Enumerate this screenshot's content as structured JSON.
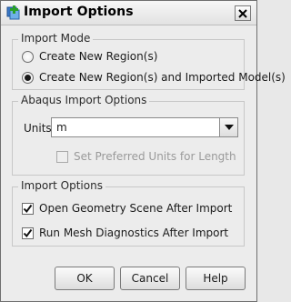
{
  "window": {
    "title": "Import Options",
    "app_icon": "import-plus-icon",
    "close_icon": "close-icon"
  },
  "import_mode": {
    "title": "Import Mode",
    "options": [
      {
        "label": "Create New Region(s)",
        "selected": false
      },
      {
        "label": "Create New Region(s) and Imported Model(s)",
        "selected": true
      }
    ]
  },
  "abaqus_options": {
    "title": "Abaqus Import Options",
    "units_label": "Units:",
    "units_value": "m",
    "preferred_units_label": "Set Preferred Units for Length",
    "preferred_units_checked": false,
    "preferred_units_enabled": false
  },
  "import_options": {
    "title": "Import Options",
    "options": [
      {
        "label": "Open Geometry Scene After Import",
        "checked": true
      },
      {
        "label": "Run Mesh Diagnostics After Import",
        "checked": true
      }
    ]
  },
  "buttons": {
    "ok": "OK",
    "cancel": "Cancel",
    "help": "Help"
  }
}
